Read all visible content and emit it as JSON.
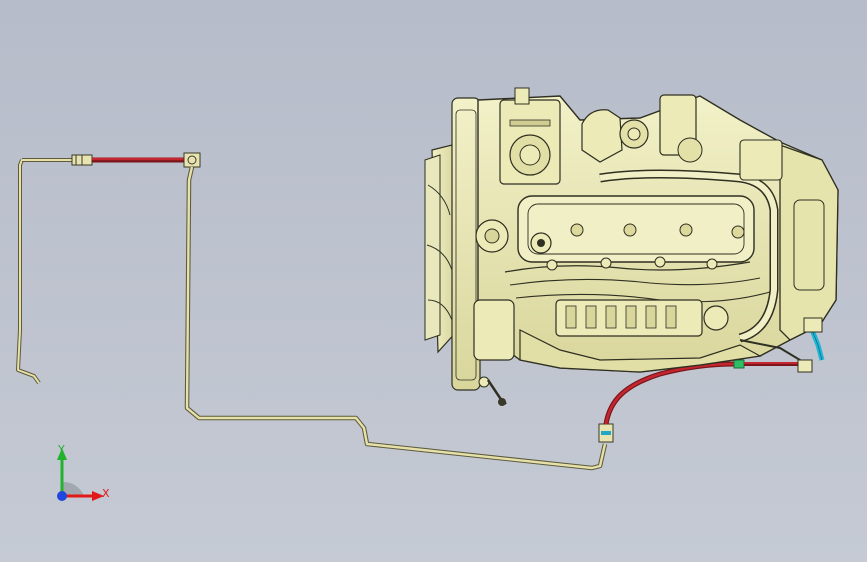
{
  "viewport": {
    "background_top": "#b6bcc9",
    "background_bottom": "#c5cad4"
  },
  "model": {
    "engine_color": "#ecebb8",
    "engine_shade": "#c9c78c",
    "engine_edge": "#2f2f22",
    "hose_red": "#c4262f",
    "pipe_color": "#e6e1a9",
    "pipe_edge": "#5d5a3d",
    "fitting_green": "#2cbf63",
    "fitting_cyan": "#22b6d6"
  },
  "triad": {
    "x_label": "X",
    "y_label": "Y",
    "x_color": "#e11919",
    "y_color": "#23b22d",
    "z_color": "#2046e0"
  }
}
